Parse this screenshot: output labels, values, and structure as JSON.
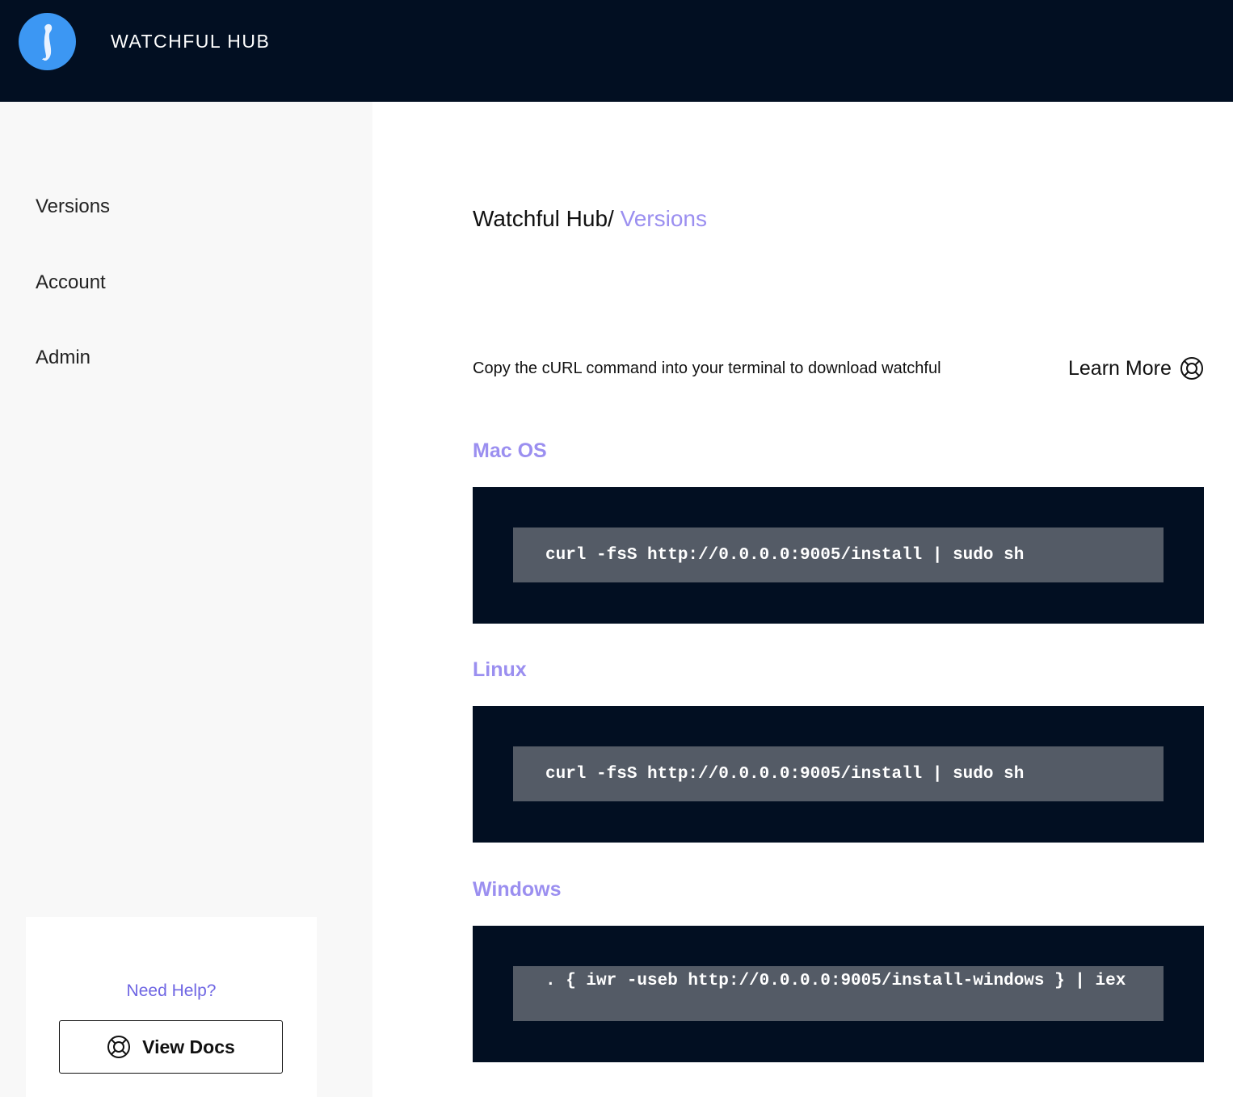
{
  "header": {
    "brand": "WATCHFUL HUB",
    "logo_icon": "meerkat-logo-icon",
    "background": "#020f22"
  },
  "sidebar": {
    "items": [
      {
        "label": "Versions"
      },
      {
        "label": "Account"
      },
      {
        "label": "Admin"
      }
    ],
    "help": {
      "title": "Need Help?",
      "button_label": "View Docs",
      "button_icon": "lifebuoy-icon"
    }
  },
  "breadcrumb": {
    "root": "Watchful Hub/",
    "current": "Versions"
  },
  "main": {
    "intro": "Copy the cURL command into your terminal to download watchful",
    "learn_more": "Learn More",
    "learn_more_icon": "lifebuoy-icon",
    "sections": [
      {
        "title": "Mac OS",
        "command": "curl -fsS http://0.0.0.0:9005/install | sudo sh"
      },
      {
        "title": "Linux",
        "command": "curl -fsS http://0.0.0.0:9005/install | sudo sh"
      },
      {
        "title": "Windows",
        "command": ". { iwr -useb http://0.0.0.0:9005/install-windows } | iex"
      }
    ]
  },
  "colors": {
    "accent": "#9b8ff0",
    "link": "#6f66e3",
    "panel": "#020f22",
    "code_bg": "#545b66"
  }
}
